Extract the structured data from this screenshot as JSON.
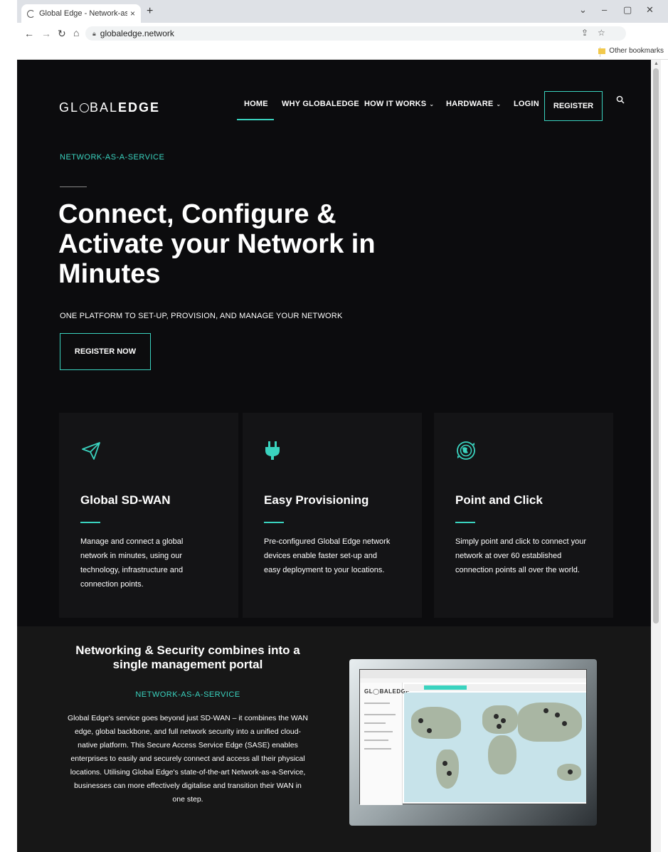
{
  "browser": {
    "tab_title": "Global Edge - Network-as-a-Serv",
    "tab_close": "×",
    "new_tab": "+",
    "url": "globaledge.network",
    "bookmarks_other": "Other bookmarks",
    "window_controls": [
      "⌄",
      "–",
      "▢",
      "✕"
    ]
  },
  "site": {
    "logo": {
      "part1": "GL",
      "part2": "BAL",
      "part3": "EDGE"
    },
    "nav": {
      "home": "HOME",
      "why": "WHY GLOBALEDGE",
      "how": "HOW IT WORKS",
      "hardware": "HARDWARE",
      "login": "LOGIN",
      "register": "REGISTER"
    },
    "hero": {
      "eyebrow": "NETWORK-AS-A-SERVICE",
      "headline": "Connect, Configure & Activate your Network in Minutes",
      "subline": "ONE PLATFORM TO SET-UP, PROVISION, AND MANAGE YOUR NETWORK",
      "cta": "REGISTER NOW"
    },
    "features": [
      {
        "icon": "paper-plane-icon",
        "title": "Global SD-WAN",
        "text": "Manage and connect a global network in minutes, using our technology, infrastructure and connection points."
      },
      {
        "icon": "plug-icon",
        "title": "Easy Provisioning",
        "text": "Pre-configured Global Edge network devices enable faster set-up and easy deployment to your locations."
      },
      {
        "icon": "globe-sync-icon",
        "title": "Point and Click",
        "text": "Simply point and click to connect your network at over 60 established connection points all over the world."
      }
    ],
    "section2": {
      "heading": "Networking & Security combines into a single management portal",
      "eyebrow": "NETWORK-AS-A-SERVICE",
      "body": "Global Edge's service goes beyond just SD-WAN – it combines the WAN edge, global backbone, and full network security into a unified cloud-native platform. This Secure Access Service Edge (SASE) enables enterprises to easily and securely connect and access all their physical locations. Utilising Global Edge's state-of-the-art Network-as-a-Service, businesses can more effectively digitalise and transition their WAN in one step.",
      "portal_logo": "GL◯BALEDGE"
    }
  },
  "colors": {
    "accent": "#3ad3bf",
    "page_bg": "#0c0c0e",
    "card_bg": "#141416",
    "section_bg": "#171717"
  }
}
